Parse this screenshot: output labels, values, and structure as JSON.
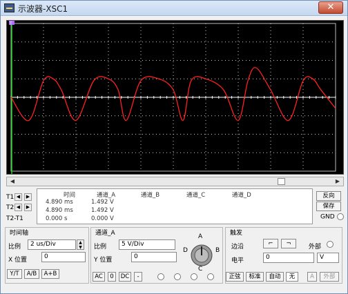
{
  "window": {
    "title": "示波器-XSC1",
    "close": "✕"
  },
  "screen": {
    "marker": "T"
  },
  "chart_data": {
    "type": "line",
    "title": "",
    "xlabel": "",
    "ylabel": "",
    "timebase_us_per_div": 2,
    "volts_per_div": 5,
    "x_divisions": 10,
    "y_divisions": 8,
    "grid": true,
    "series": [
      {
        "name": "",
        "color": "#ff2020",
        "x_div": [
          0.0,
          0.55,
          1.0,
          1.3,
          1.55,
          2.0,
          2.55,
          3.0,
          3.3,
          3.55,
          4.0,
          4.55,
          5.0,
          5.3,
          5.55,
          6.0,
          6.55,
          7.0,
          7.3,
          7.55,
          8.0,
          8.55,
          9.0,
          9.3,
          9.55,
          10.0
        ],
        "y_div": [
          0.0,
          -1.25,
          0.9,
          1.0,
          0.4,
          -1.25,
          0.9,
          1.0,
          0.4,
          -1.25,
          0.9,
          1.0,
          0.4,
          -1.25,
          0.9,
          1.0,
          0.4,
          -1.25,
          0.9,
          1.6,
          0.4,
          -1.25,
          0.9,
          1.0,
          0.4,
          -0.6
        ]
      }
    ]
  },
  "readout": {
    "t1_label": "T1",
    "t2_label": "T2",
    "t2t1_label": "T2-T1",
    "headers": {
      "time": "时间",
      "cha": "通道_A",
      "chb": "通道_B",
      "chc": "通道_C",
      "chd": "通道_D"
    },
    "rows": [
      {
        "time": "4.890 ms",
        "cha": "1.492 V"
      },
      {
        "time": "4.890 ms",
        "cha": "1.492 V"
      },
      {
        "time": "0.000 s",
        "cha": "0.000 V"
      }
    ],
    "reverse": "反向",
    "save": "保存",
    "gnd": "GND"
  },
  "timebase": {
    "title": "时间轴",
    "scale_label": "比例",
    "scale_value": "2 us/Div",
    "xpos_label": "X 位置",
    "xpos_value": "0",
    "btn_yt": "Y/T",
    "btn_ab": "A/B",
    "btn_aplusb": "A+B"
  },
  "channel_a": {
    "title": "通道_A",
    "scale_label": "比例",
    "scale_value": "5  V/Div",
    "ypos_label": "Y 位置",
    "ypos_value": "0",
    "btn_ac": "AC",
    "btn_zero": "0",
    "btn_dc": "DC",
    "btn_minus": "-",
    "knob_a": "A",
    "knob_b": "B",
    "knob_c": "C",
    "knob_d": "D"
  },
  "trigger": {
    "title": "触发",
    "edge_label": "边沿",
    "external_label": "外部",
    "level_label": "电平",
    "level_value": "0",
    "level_unit": "V",
    "btn_normal": "正弦",
    "btn_standard": "标准",
    "btn_auto": "自动",
    "btn_none": "无",
    "src_a": "A",
    "src_ext": "外部"
  }
}
